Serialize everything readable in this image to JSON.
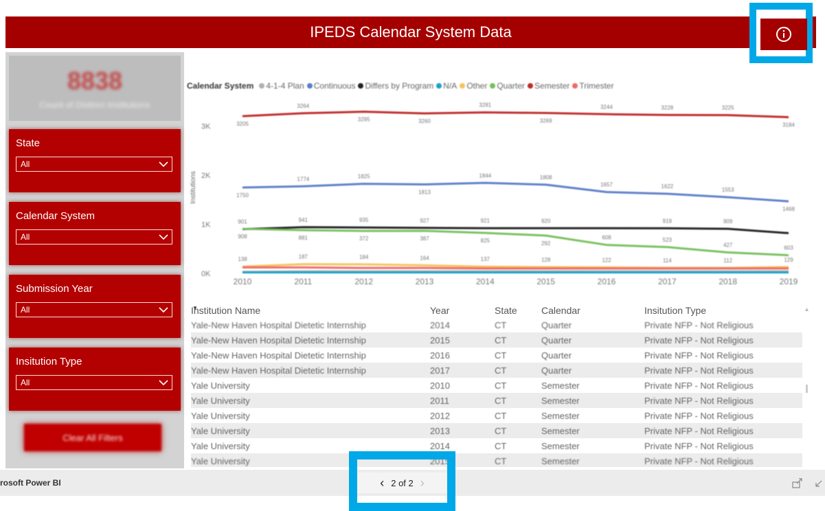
{
  "header": {
    "title": "IPEDS Calendar System Data"
  },
  "sidebar": {
    "kpi": {
      "value": "8838",
      "label": "Count of Distinct Institutions"
    },
    "filters": [
      {
        "title": "State",
        "value": "All"
      },
      {
        "title": "Calendar System",
        "value": "All"
      },
      {
        "title": "Submission Year",
        "value": "All"
      },
      {
        "title": "Insitution Type",
        "value": "All"
      }
    ],
    "clear_label": "Clear All Filters"
  },
  "chart_data": {
    "type": "line",
    "legend_title": "Calendar System",
    "legend_position": "top-left",
    "ylabel": "Institutions",
    "ylim": [
      0,
      3500
    ],
    "yticks": [
      "0K",
      "1K",
      "2K",
      "3K"
    ],
    "x": [
      2010,
      2011,
      2012,
      2013,
      2014,
      2015,
      2016,
      2017,
      2018,
      2019
    ],
    "series": [
      {
        "name": "4-1-4 Plan",
        "color": "#b0b0b0",
        "values": [
          30,
          40,
          40,
          40,
          40,
          40,
          40,
          40,
          40,
          40
        ]
      },
      {
        "name": "Continuous",
        "color": "#5b7ec9",
        "values": [
          1750,
          1774,
          1825,
          1813,
          1844,
          1808,
          1657,
          1622,
          1553,
          1468
        ]
      },
      {
        "name": "Differs by Program",
        "color": "#222222",
        "values": [
          901,
          941,
          935,
          927,
          921,
          920,
          920,
          919,
          909,
          820
        ]
      },
      {
        "name": "N/A",
        "color": "#17a3c4",
        "values": [
          20,
          20,
          20,
          20,
          20,
          20,
          20,
          20,
          20,
          20
        ]
      },
      {
        "name": "Other",
        "color": "#f6c35c",
        "values": [
          138,
          187,
          184,
          164,
          137,
          128,
          122,
          114,
          112,
          129
        ]
      },
      {
        "name": "Quarter",
        "color": "#77c05d",
        "values": [
          908,
          881,
          865,
          867,
          825,
          770,
          580,
          535,
          427,
          370
        ]
      },
      {
        "name": "Semester",
        "color": "#c02a2a",
        "values": [
          3205,
          3264,
          3295,
          3260,
          3281,
          3269,
          3244,
          3228,
          3225,
          3184
        ]
      },
      {
        "name": "Trimester",
        "color": "#ef6a6a",
        "values": [
          120,
          120,
          110,
          110,
          100,
          100,
          100,
          100,
          100,
          100
        ]
      }
    ],
    "labels": [
      {
        "series": "Semester",
        "x": 2010,
        "text": "3205",
        "pos": "below"
      },
      {
        "series": "Semester",
        "x": 2011,
        "text": "3264",
        "pos": "above"
      },
      {
        "series": "Semester",
        "x": 2012,
        "text": "3295",
        "pos": "below"
      },
      {
        "series": "Semester",
        "x": 2013,
        "text": "3260",
        "pos": "below"
      },
      {
        "series": "Semester",
        "x": 2014,
        "text": "3281",
        "pos": "above"
      },
      {
        "series": "Semester",
        "x": 2015,
        "text": "3269",
        "pos": "below"
      },
      {
        "series": "Semester",
        "x": 2016,
        "text": "3244",
        "pos": "above"
      },
      {
        "series": "Semester",
        "x": 2017,
        "text": "3228",
        "pos": "above"
      },
      {
        "series": "Semester",
        "x": 2018,
        "text": "3225",
        "pos": "above"
      },
      {
        "series": "Semester",
        "x": 2019,
        "text": "3184",
        "pos": "below"
      },
      {
        "series": "Continuous",
        "x": 2010,
        "text": "1750",
        "pos": "below"
      },
      {
        "series": "Continuous",
        "x": 2011,
        "text": "1774",
        "pos": "above"
      },
      {
        "series": "Continuous",
        "x": 2012,
        "text": "1825",
        "pos": "above"
      },
      {
        "series": "Continuous",
        "x": 2013,
        "text": "1813",
        "pos": "below"
      },
      {
        "series": "Continuous",
        "x": 2014,
        "text": "1844",
        "pos": "above"
      },
      {
        "series": "Continuous",
        "x": 2015,
        "text": "1808",
        "pos": "above"
      },
      {
        "series": "Continuous",
        "x": 2016,
        "text": "1657",
        "pos": "above"
      },
      {
        "series": "Continuous",
        "x": 2017,
        "text": "1622",
        "pos": "above"
      },
      {
        "series": "Continuous",
        "x": 2018,
        "text": "1553",
        "pos": "above"
      },
      {
        "series": "Continuous",
        "x": 2019,
        "text": "1468",
        "pos": "below"
      },
      {
        "series": "Differs by Program",
        "x": 2010,
        "text": "901",
        "pos": "above"
      },
      {
        "series": "Differs by Program",
        "x": 2011,
        "text": "941",
        "pos": "above"
      },
      {
        "series": "Differs by Program",
        "x": 2012,
        "text": "935",
        "pos": "above"
      },
      {
        "series": "Differs by Program",
        "x": 2013,
        "text": "927",
        "pos": "above"
      },
      {
        "series": "Differs by Program",
        "x": 2014,
        "text": "921",
        "pos": "above"
      },
      {
        "series": "Differs by Program",
        "x": 2015,
        "text": "920",
        "pos": "above"
      },
      {
        "series": "Differs by Program",
        "x": 2017,
        "text": "919",
        "pos": "above"
      },
      {
        "series": "Differs by Program",
        "x": 2018,
        "text": "909",
        "pos": "above"
      },
      {
        "series": "Quarter",
        "x": 2010,
        "text": "908",
        "pos": "below"
      },
      {
        "series": "Quarter",
        "x": 2011,
        "text": "881",
        "pos": "below"
      },
      {
        "series": "Quarter",
        "x": 2012,
        "text": "372",
        "pos": "below"
      },
      {
        "series": "Quarter",
        "x": 2013,
        "text": "387",
        "pos": "below"
      },
      {
        "series": "Quarter",
        "x": 2014,
        "text": "825",
        "pos": "below"
      },
      {
        "series": "Quarter",
        "x": 2015,
        "text": "292",
        "pos": "below"
      },
      {
        "series": "Quarter",
        "x": 2016,
        "text": "608",
        "pos": "above"
      },
      {
        "series": "Quarter",
        "x": 2017,
        "text": "523",
        "pos": "above"
      },
      {
        "series": "Quarter",
        "x": 2018,
        "text": "427",
        "pos": "above"
      },
      {
        "series": "Quarter",
        "x": 2019,
        "text": "603",
        "pos": "above"
      },
      {
        "series": "Other",
        "x": 2010,
        "text": "138",
        "pos": "above"
      },
      {
        "series": "Other",
        "x": 2011,
        "text": "187",
        "pos": "above"
      },
      {
        "series": "Other",
        "x": 2012,
        "text": "184",
        "pos": "above"
      },
      {
        "series": "Other",
        "x": 2013,
        "text": "164",
        "pos": "above"
      },
      {
        "series": "Other",
        "x": 2014,
        "text": "137",
        "pos": "above"
      },
      {
        "series": "Other",
        "x": 2015,
        "text": "128",
        "pos": "above"
      },
      {
        "series": "Other",
        "x": 2016,
        "text": "122",
        "pos": "above"
      },
      {
        "series": "Other",
        "x": 2017,
        "text": "114",
        "pos": "above"
      },
      {
        "series": "Other",
        "x": 2018,
        "text": "112",
        "pos": "above"
      },
      {
        "series": "Other",
        "x": 2019,
        "text": "129",
        "pos": "above"
      }
    ]
  },
  "table": {
    "columns": [
      "Institution Name",
      "Year",
      "State",
      "Calendar",
      "Insitution Type"
    ],
    "rows": [
      [
        "Yale-New Haven Hospital Dietetic Internship",
        "2014",
        "CT",
        "Quarter",
        "Private NFP - Not Religious"
      ],
      [
        "Yale-New Haven Hospital Dietetic Internship",
        "2015",
        "CT",
        "Quarter",
        "Private NFP - Not Religious"
      ],
      [
        "Yale-New Haven Hospital Dietetic Internship",
        "2016",
        "CT",
        "Quarter",
        "Private NFP - Not Religious"
      ],
      [
        "Yale-New Haven Hospital Dietetic Internship",
        "2017",
        "CT",
        "Quarter",
        "Private NFP - Not Religious"
      ],
      [
        "Yale University",
        "2010",
        "CT",
        "Semester",
        "Private NFP - Not Religious"
      ],
      [
        "Yale University",
        "2011",
        "CT",
        "Semester",
        "Private NFP - Not Religious"
      ],
      [
        "Yale University",
        "2012",
        "CT",
        "Semester",
        "Private NFP - Not Religious"
      ],
      [
        "Yale University",
        "2013",
        "CT",
        "Semester",
        "Private NFP - Not Religious"
      ],
      [
        "Yale University",
        "2014",
        "CT",
        "Semester",
        "Private NFP - Not Religious"
      ],
      [
        "Yale University",
        "2015",
        "CT",
        "Semester",
        "Private NFP - Not Religious"
      ]
    ]
  },
  "footer": {
    "brand": "rosoft Power BI",
    "pager": "2 of 2"
  },
  "colors": {
    "brand_red": "#a50000",
    "highlight": "#00a8e8"
  },
  "icons": [
    "info-icon",
    "chevron-down-icon",
    "chevron-left-icon",
    "chevron-right-icon",
    "share-icon",
    "expand-icon"
  ]
}
